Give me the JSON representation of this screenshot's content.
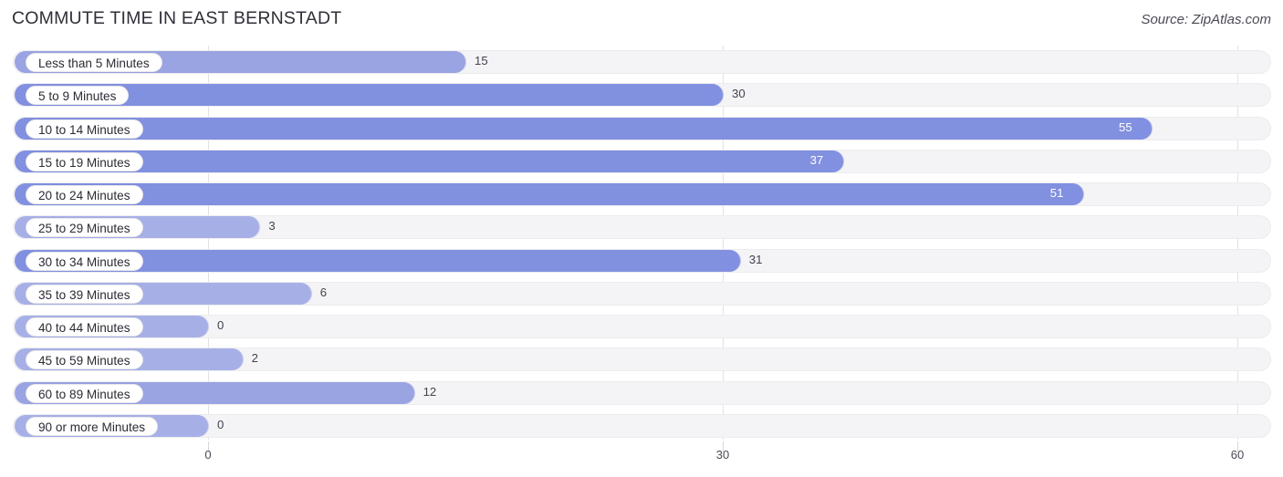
{
  "header": {
    "title": "COMMUTE TIME IN EAST BERNSTADT",
    "source": "Source: ZipAtlas.com"
  },
  "colors": {
    "bar_light": "#a7b0e6",
    "bar_mid": "#9aa4e3",
    "bar_strong": "#8290e0",
    "track": "#f4f4f6",
    "grid": "#e2e2e6",
    "text": "#3a3a45",
    "value_inside": "#ffffff"
  },
  "chart_data": {
    "type": "bar",
    "orientation": "horizontal",
    "title": "COMMUTE TIME IN EAST BERNSTADT",
    "xlabel": "",
    "ylabel": "",
    "xlim": [
      0,
      60
    ],
    "xticks": [
      0,
      30,
      60
    ],
    "xtick_labels": [
      "0",
      "30",
      "60"
    ],
    "grid": true,
    "legend": "none",
    "categories": [
      "Less than 5 Minutes",
      "5 to 9 Minutes",
      "10 to 14 Minutes",
      "15 to 19 Minutes",
      "20 to 24 Minutes",
      "25 to 29 Minutes",
      "30 to 34 Minutes",
      "35 to 39 Minutes",
      "40 to 44 Minutes",
      "45 to 59 Minutes",
      "60 to 89 Minutes",
      "90 or more Minutes"
    ],
    "values": [
      15,
      30,
      55,
      37,
      51,
      3,
      31,
      6,
      0,
      2,
      12,
      0
    ],
    "value_labels": [
      "15",
      "30",
      "55",
      "37",
      "51",
      "3",
      "31",
      "6",
      "0",
      "2",
      "12",
      "0"
    ]
  }
}
